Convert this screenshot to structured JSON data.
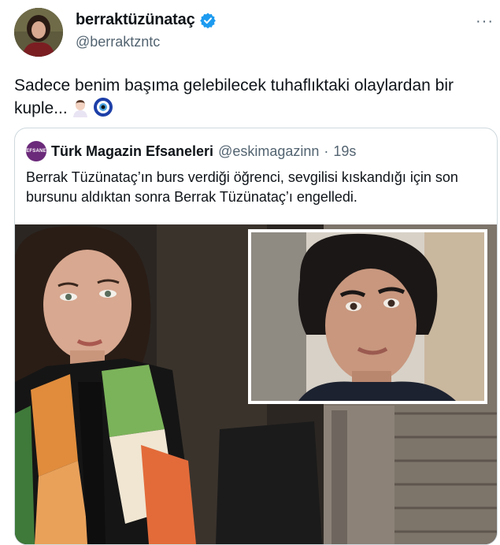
{
  "author": {
    "display_name": "berraktüzünataç",
    "handle": "@berraktzntc",
    "verified_icon": "verified-badge-icon",
    "accent": "#1d9bf0"
  },
  "tweet": {
    "text": "Sadece benim başıma gelebilecek tuhaflıktaki olaylardan bir kuple...",
    "emojis": [
      "woman-facepalming-icon",
      "nazar-amulet-icon"
    ]
  },
  "quoted": {
    "avatar_text": "EFSANE",
    "display_name": "Türk Magazin Efsaneleri",
    "handle": "@eskimagazinn",
    "separator": "·",
    "time": "19s",
    "text": "Berrak Tüzünataç’ın burs verdiği öğrenci, sevgilisi kıskandığı için son bursunu aldıktan sonra Berrak Tüzünataç’ı engelledi."
  },
  "menu": {
    "more_label": "···"
  }
}
